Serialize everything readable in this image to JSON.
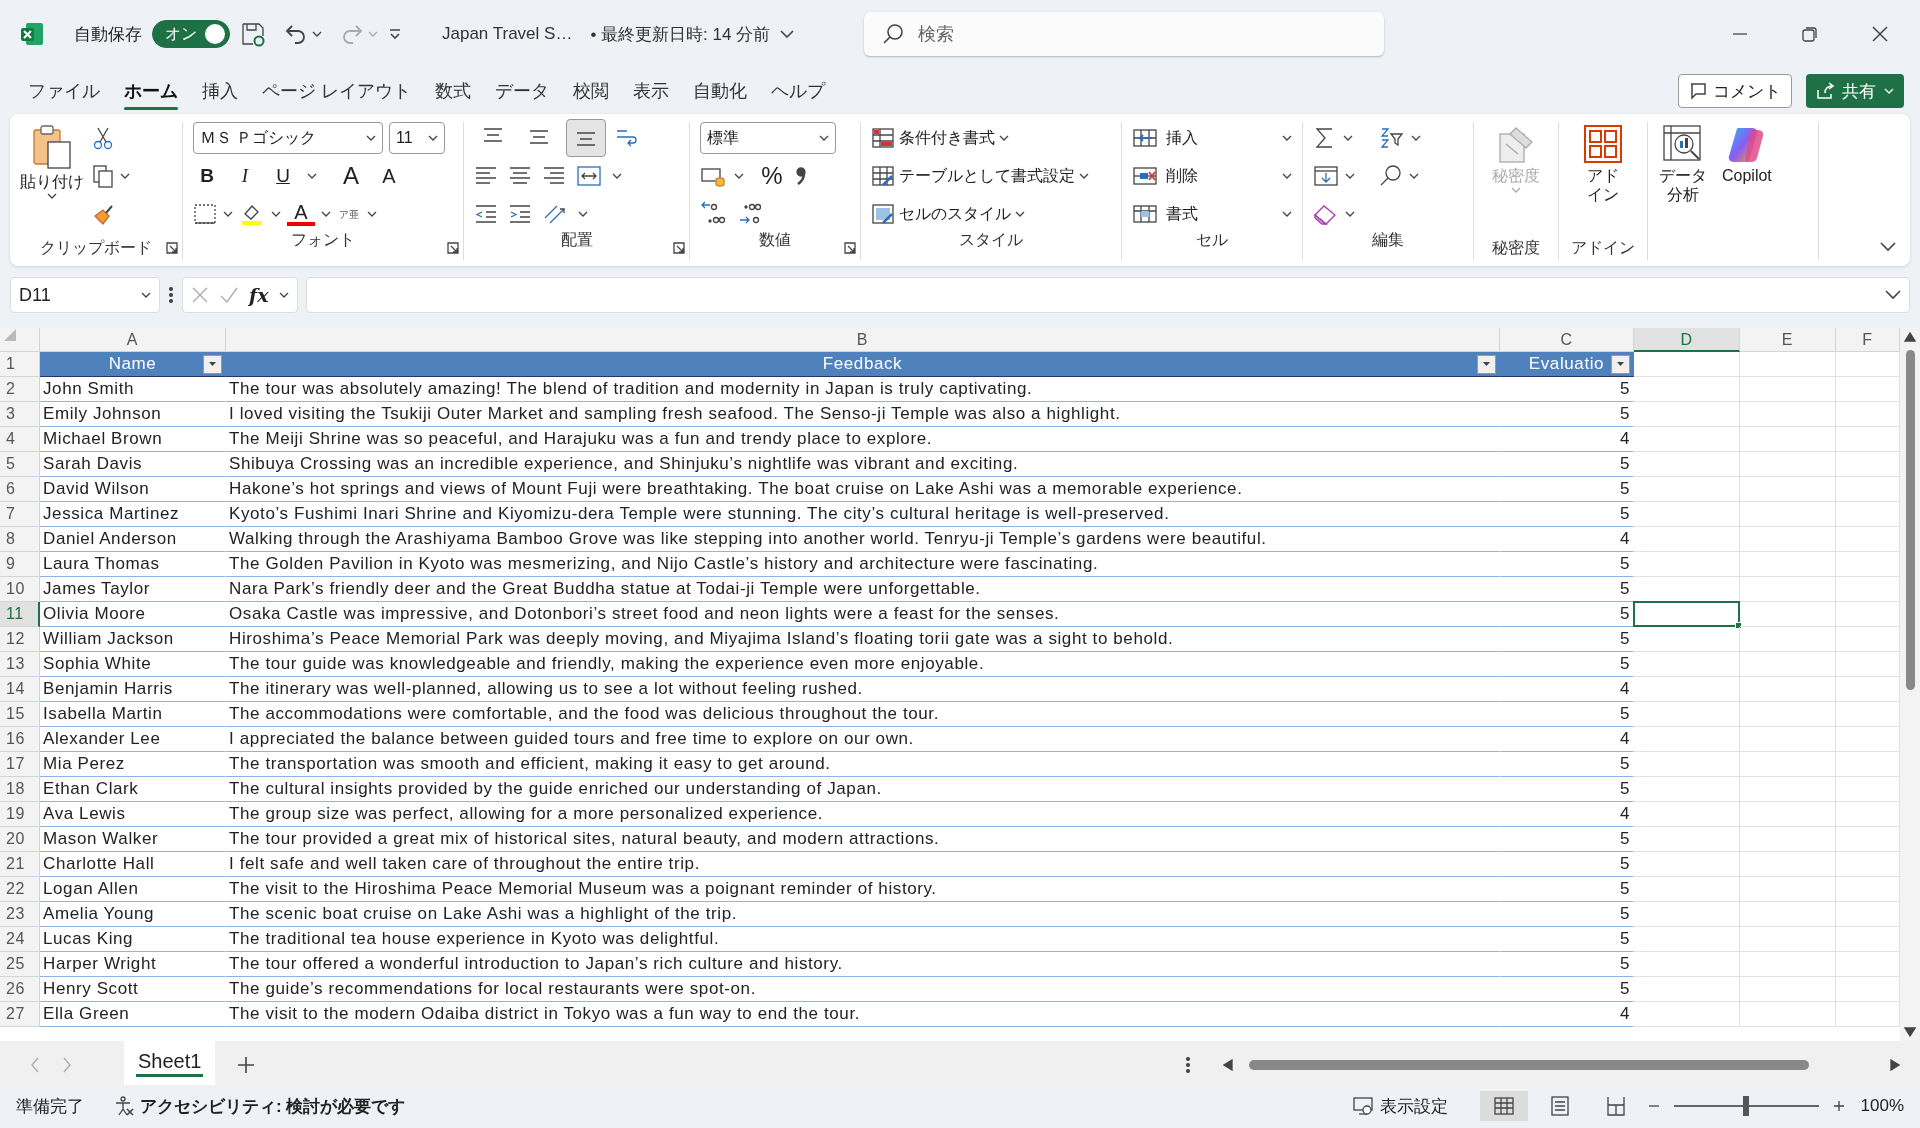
{
  "title_bar": {
    "autosave_label": "自動保存",
    "autosave_toggle": {
      "label": "オン",
      "on": true
    },
    "file_name": "Japan Travel S…",
    "save_status": "• 最終更新日時: 14 分前",
    "search": {
      "placeholder": "検索"
    }
  },
  "menu_tabs": [
    {
      "label": "ファイル",
      "selected": false
    },
    {
      "label": "ホーム",
      "selected": true
    },
    {
      "label": "挿入",
      "selected": false
    },
    {
      "label": "ページ レイアウト",
      "selected": false
    },
    {
      "label": "数式",
      "selected": false
    },
    {
      "label": "データ",
      "selected": false
    },
    {
      "label": "校閲",
      "selected": false
    },
    {
      "label": "表示",
      "selected": false
    },
    {
      "label": "自動化",
      "selected": false
    },
    {
      "label": "ヘルプ",
      "selected": false
    }
  ],
  "comment_button": "コメント",
  "share_button": "共有",
  "ribbon": {
    "clipboard": {
      "paste": "貼り付け",
      "label": "クリップボード"
    },
    "font": {
      "font_name": "ＭＳ Ｐゴシック",
      "font_size": "11",
      "bold": "B",
      "italic": "I",
      "underline": "U",
      "grow_font": "A",
      "shrink_font": "A",
      "font_color": "A",
      "phonetic": "ア亜",
      "label": "フォント"
    },
    "alignment": {
      "vertical": [
        {
          "kind": "top",
          "selected": false
        },
        {
          "kind": "middle",
          "selected": false
        },
        {
          "kind": "bottom",
          "selected": true
        }
      ],
      "label": "配置"
    },
    "number": {
      "format": "標準",
      "percent": "%",
      "label": "数値"
    },
    "styles": {
      "items": [
        "条件付き書式",
        "テーブルとして書式設定",
        "セルのスタイル"
      ],
      "label": "スタイル"
    },
    "cells": {
      "items": [
        "挿入",
        "削除",
        "書式"
      ],
      "label": "セル"
    },
    "editing": {
      "label": "編集"
    },
    "sensitivity": {
      "button": "秘密度",
      "disabled": true,
      "label": "秘密度"
    },
    "addins": {
      "button": "アドイン",
      "label": "アドイン"
    },
    "analysis": {
      "data_analysis": "データ分析",
      "copilot": "Copilot"
    }
  },
  "formula_bar": {
    "name_box": "D11",
    "fx": "fx"
  },
  "columns": [
    {
      "label": "A",
      "selected": false
    },
    {
      "label": "B",
      "selected": false
    },
    {
      "label": "C",
      "selected": false
    },
    {
      "label": "D",
      "selected": true
    },
    {
      "label": "E",
      "selected": false
    },
    {
      "label": "F",
      "selected": false
    }
  ],
  "table": {
    "headers": [
      "Name",
      "Feedback",
      "Evaluatio"
    ],
    "rows": [
      {
        "name": "John Smith",
        "feedback": "The tour was absolutely amazing! The blend of tradition and modernity in Japan is truly captivating.",
        "evaluation": "5"
      },
      {
        "name": "Emily Johnson",
        "feedback": "I loved visiting the Tsukiji Outer Market and sampling fresh seafood. The Senso-ji Temple was also a highlight.",
        "evaluation": "5"
      },
      {
        "name": "Michael Brown",
        "feedback": "The Meiji Shrine was so peaceful, and Harajuku was a fun and trendy place to explore.",
        "evaluation": "4"
      },
      {
        "name": "Sarah Davis",
        "feedback": "Shibuya Crossing was an incredible experience, and Shinjuku’s nightlife was vibrant and exciting.",
        "evaluation": "5"
      },
      {
        "name": "David Wilson",
        "feedback": "Hakone’s hot springs and views of Mount Fuji were breathtaking. The boat cruise on Lake Ashi was a memorable experience.",
        "evaluation": "5"
      },
      {
        "name": "Jessica Martinez",
        "feedback": "Kyoto’s Fushimi Inari Shrine and Kiyomizu-dera Temple were stunning. The city’s cultural heritage is well-preserved.",
        "evaluation": "5"
      },
      {
        "name": "Daniel Anderson",
        "feedback": "Walking through the Arashiyama Bamboo Grove was like stepping into another world. Tenryu-ji Temple’s gardens were beautiful.",
        "evaluation": "4"
      },
      {
        "name": "Laura Thomas",
        "feedback": "The Golden Pavilion in Kyoto was mesmerizing, and Nijo Castle’s history and architecture were fascinating.",
        "evaluation": "5"
      },
      {
        "name": "James Taylor",
        "feedback": "Nara Park’s friendly deer and the Great Buddha statue at Todai-ji Temple were unforgettable.",
        "evaluation": "5"
      },
      {
        "name": "Olivia Moore",
        "feedback": "Osaka Castle was impressive, and Dotonbori’s street food and neon lights were a feast for the senses.",
        "evaluation": "5"
      },
      {
        "name": "William Jackson",
        "feedback": "Hiroshima’s Peace Memorial Park was deeply moving, and Miyajima Island’s floating torii gate was a sight to behold.",
        "evaluation": "5"
      },
      {
        "name": "Sophia White",
        "feedback": "The tour guide was knowledgeable and friendly, making the experience even more enjoyable.",
        "evaluation": "5"
      },
      {
        "name": "Benjamin Harris",
        "feedback": "The itinerary was well-planned, allowing us to see a lot without feeling rushed.",
        "evaluation": "4"
      },
      {
        "name": "Isabella Martin",
        "feedback": "The accommodations were comfortable, and the food was delicious throughout the tour.",
        "evaluation": "5"
      },
      {
        "name": "Alexander Lee",
        "feedback": "I appreciated the balance between guided tours and free time to explore on our own.",
        "evaluation": "4"
      },
      {
        "name": "Mia Perez",
        "feedback": "The transportation was smooth and efficient, making it easy to get around.",
        "evaluation": "5"
      },
      {
        "name": "Ethan Clark",
        "feedback": "The cultural insights provided by the guide enriched our understanding of Japan.",
        "evaluation": "5"
      },
      {
        "name": "Ava Lewis",
        "feedback": "The group size was perfect, allowing for a more personalized experience.",
        "evaluation": "4"
      },
      {
        "name": "Mason Walker",
        "feedback": "The tour provided a great mix of historical sites, natural beauty, and modern attractions.",
        "evaluation": "5"
      },
      {
        "name": "Charlotte Hall",
        "feedback": "I felt safe and well taken care of throughout the entire trip.",
        "evaluation": "5"
      },
      {
        "name": "Logan Allen",
        "feedback": "The visit to the Hiroshima Peace Memorial Museum was a poignant reminder of history.",
        "evaluation": "5"
      },
      {
        "name": "Amelia Young",
        "feedback": "The scenic boat cruise on Lake Ashi was a highlight of the trip.",
        "evaluation": "5"
      },
      {
        "name": "Lucas King",
        "feedback": "The traditional tea house experience in Kyoto was delightful.",
        "evaluation": "5"
      },
      {
        "name": "Harper Wright",
        "feedback": "The tour offered a wonderful introduction to Japan’s rich culture and history.",
        "evaluation": "5"
      },
      {
        "name": "Henry Scott",
        "feedback": "The guide’s recommendations for local restaurants were spot-on.",
        "evaluation": "5"
      },
      {
        "name": "Ella Green",
        "feedback": "The visit to the modern Odaiba district in Tokyo was a fun way to end the tour.",
        "evaluation": "4"
      }
    ]
  },
  "row_headers": [
    {
      "label": "1",
      "selected": false
    },
    {
      "label": "2",
      "selected": false
    },
    {
      "label": "3",
      "selected": false
    },
    {
      "label": "4",
      "selected": false
    },
    {
      "label": "5",
      "selected": false
    },
    {
      "label": "6",
      "selected": false
    },
    {
      "label": "7",
      "selected": false
    },
    {
      "label": "8",
      "selected": false
    },
    {
      "label": "9",
      "selected": false
    },
    {
      "label": "10",
      "selected": false
    },
    {
      "label": "11",
      "selected": true
    },
    {
      "label": "12",
      "selected": false
    },
    {
      "label": "13",
      "selected": false
    },
    {
      "label": "14",
      "selected": false
    },
    {
      "label": "15",
      "selected": false
    },
    {
      "label": "16",
      "selected": false
    },
    {
      "label": "17",
      "selected": false
    },
    {
      "label": "18",
      "selected": false
    },
    {
      "label": "19",
      "selected": false
    },
    {
      "label": "20",
      "selected": false
    },
    {
      "label": "21",
      "selected": false
    },
    {
      "label": "22",
      "selected": false
    },
    {
      "label": "23",
      "selected": false
    },
    {
      "label": "24",
      "selected": false
    },
    {
      "label": "25",
      "selected": false
    },
    {
      "label": "26",
      "selected": false
    },
    {
      "label": "27",
      "selected": false
    }
  ],
  "sheet_tabs": [
    {
      "label": "Sheet1",
      "selected": true
    }
  ],
  "status_bar": {
    "ready": "準備完了",
    "accessibility": "アクセシビリティ: 検討が必要です",
    "display_settings": "表示設定",
    "views": [
      {
        "kind": "normal",
        "selected": true
      },
      {
        "kind": "page_layout",
        "selected": false
      },
      {
        "kind": "page_break",
        "selected": false
      }
    ],
    "zoom": {
      "level": 0.5,
      "reading": "100%"
    }
  }
}
